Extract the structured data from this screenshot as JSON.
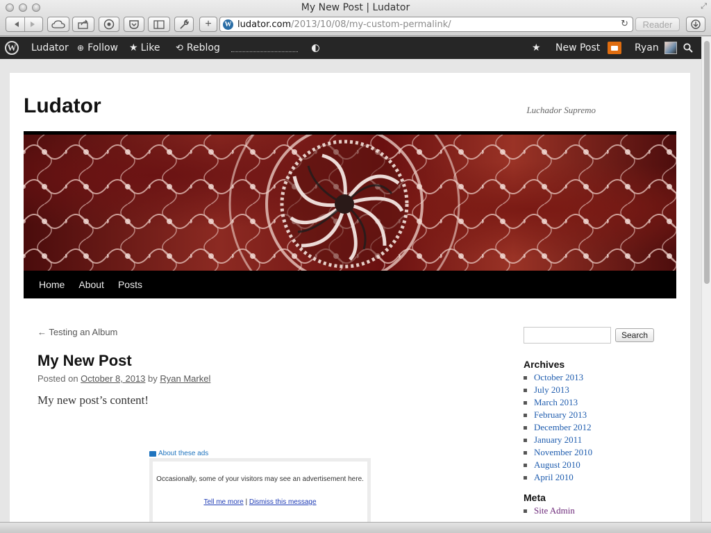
{
  "window": {
    "title": "My New Post | Ludator"
  },
  "browser": {
    "url_host": "ludator.com",
    "url_path": "/2013/10/08/my-custom-permalink/",
    "reader_label": "Reader"
  },
  "adminbar": {
    "site_name": "Ludator",
    "follow": "Follow",
    "like": "Like",
    "reblog": "Reblog",
    "new_post": "New Post",
    "user": "Ryan"
  },
  "site": {
    "title": "Ludator",
    "description": "Luchador Supremo"
  },
  "nav": [
    "Home",
    "About",
    "Posts"
  ],
  "post": {
    "prev_link": "← Testing an Album",
    "title": "My New Post",
    "posted_on": "Posted on",
    "date": "October 8, 2013",
    "by": "by",
    "author": "Ryan Markel",
    "content": "My new post’s content!"
  },
  "ads": {
    "label": "About these ads",
    "text": "Occasionally, some of your visitors may see an advertisement here.",
    "tell_me_more": "Tell me more",
    "separator": "|",
    "dismiss": "Dismiss this message"
  },
  "sidebar": {
    "search_button": "Search",
    "archives_title": "Archives",
    "archives": [
      "October 2013",
      "July 2013",
      "March 2013",
      "February 2013",
      "December 2012",
      "January 2011",
      "November 2010",
      "August 2010",
      "April 2010"
    ],
    "meta_title": "Meta",
    "meta": [
      "Site Admin"
    ]
  },
  "colors": {
    "link": "#1e5cae",
    "adminbar": "#262626",
    "notification": "#e06d10",
    "header_dark_red": "#6a1010"
  }
}
